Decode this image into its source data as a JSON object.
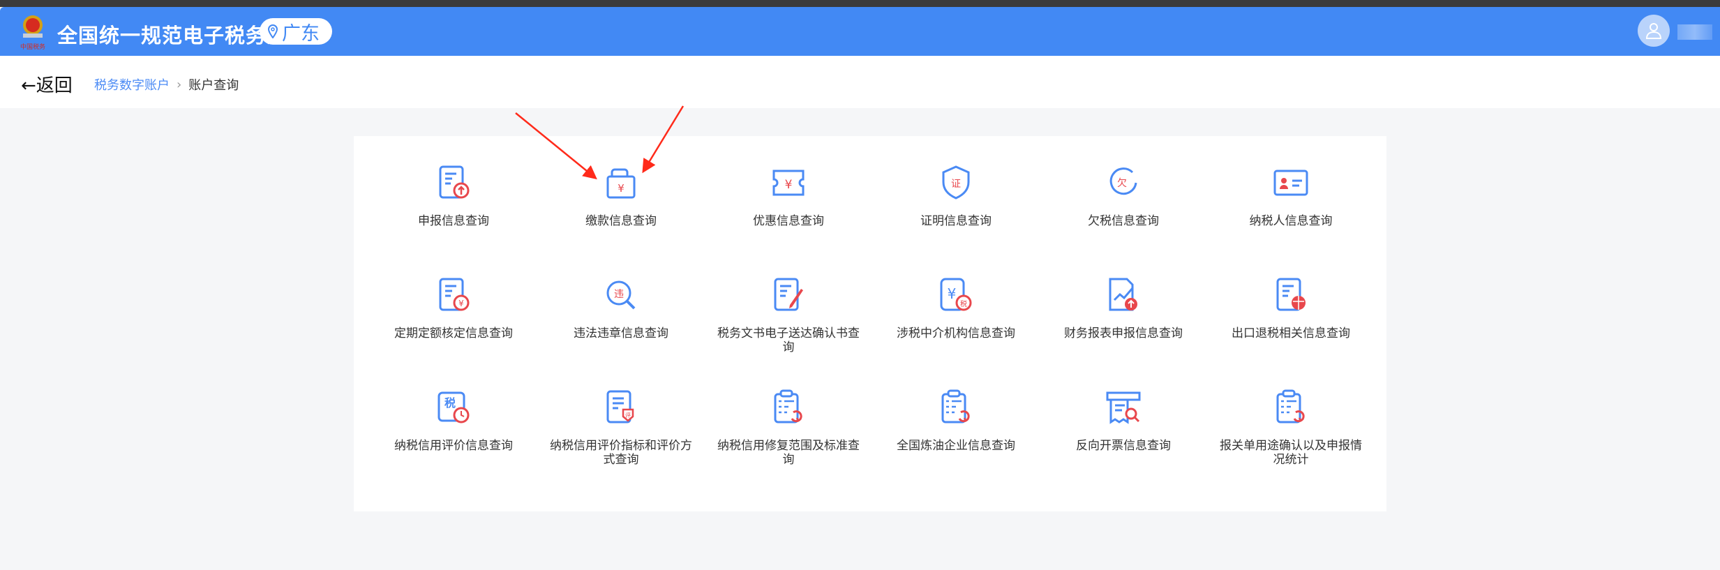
{
  "header": {
    "title": "全国统一规范电子税务局",
    "region": "广东",
    "logo_text": "中国税务",
    "brand_color": "#4289f4"
  },
  "breadcrumb": {
    "back_label": "←返回",
    "items": [
      "税务数字账户",
      "账户查询"
    ]
  },
  "items": [
    {
      "label": "申报信息查询",
      "icon": "doc-upload-icon"
    },
    {
      "label": "缴款信息查询",
      "icon": "money-bag-icon"
    },
    {
      "label": "优惠信息查询",
      "icon": "coupon-icon"
    },
    {
      "label": "证明信息查询",
      "icon": "certificate-shield-icon"
    },
    {
      "label": "欠税信息查询",
      "icon": "owed-tax-icon"
    },
    {
      "label": "纳税人信息查询",
      "icon": "id-card-icon"
    },
    {
      "label": "定期定额核定信息查询",
      "icon": "doc-yuan-icon"
    },
    {
      "label": "违法违章信息查询",
      "icon": "search-violation-icon"
    },
    {
      "label": "税务文书电子送达确认书查询",
      "icon": "doc-edit-icon"
    },
    {
      "label": "涉税中介机构信息查询",
      "icon": "agency-icon"
    },
    {
      "label": "财务报表申报信息查询",
      "icon": "report-chart-icon"
    },
    {
      "label": "出口退税相关信息查询",
      "icon": "export-globe-icon"
    },
    {
      "label": "纳税信用评价信息查询",
      "icon": "tax-credit-icon"
    },
    {
      "label": "纳税信用评价指标和评价方式查询",
      "icon": "doc-evaluate-icon"
    },
    {
      "label": "纳税信用修复范围及标准查询",
      "icon": "clipboard-refresh-icon"
    },
    {
      "label": "全国炼油企业信息查询",
      "icon": "clipboard-refresh-icon"
    },
    {
      "label": "反向开票信息查询",
      "icon": "invoice-search-icon"
    },
    {
      "label": "报关单用途确认以及申报情况统计",
      "icon": "clipboard-refresh-icon"
    }
  ],
  "colors": {
    "icon_blue": "#4a8af4",
    "icon_red": "#e8474c",
    "annotation_arrow": "#ff2a1a"
  }
}
